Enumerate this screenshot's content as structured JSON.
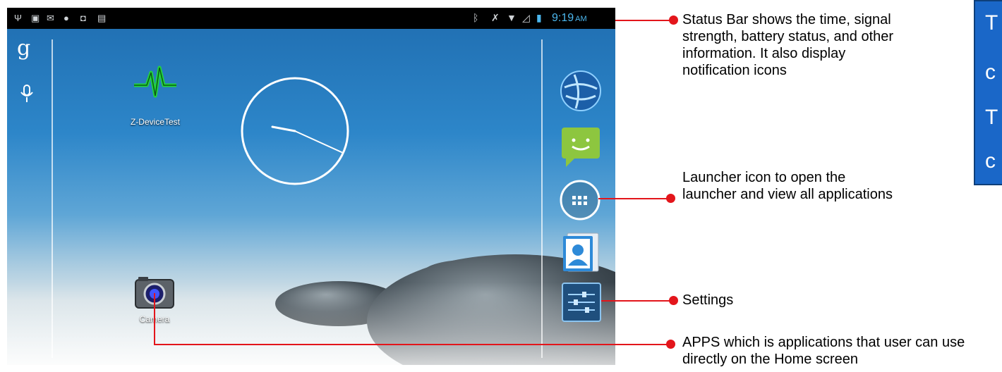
{
  "status_bar": {
    "time": "9:19",
    "ampm": "AM"
  },
  "home": {
    "apps": [
      {
        "label": "Z-DeviceTest"
      },
      {
        "label": "Camera"
      }
    ],
    "dock": [
      "browser-icon",
      "messaging-icon",
      "launcher-icon",
      "contacts-icon",
      "settings-icon"
    ]
  },
  "annotations": {
    "status_bar": "Status Bar shows the time, signal strength, battery status, and other information. It also display notification icons",
    "launcher": "Launcher icon to open the launcher and view all applications",
    "settings": "Settings",
    "apps": "APPS  which is applications that user can use directly on the Home screen"
  },
  "side_box_text": [
    "T",
    "c",
    "T",
    "c"
  ],
  "colors": {
    "annotation": "#e3151b",
    "time": "#4cb7ee",
    "side_box": "#1a67c8"
  }
}
